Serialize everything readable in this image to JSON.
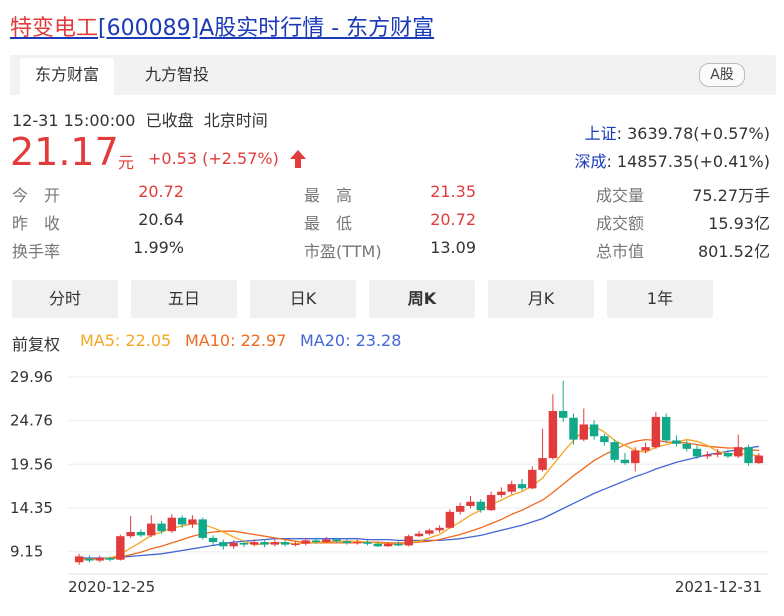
{
  "header": {
    "stock_name": "特变电工",
    "title_rest": "[600089]A股实时行情 - 东方财富"
  },
  "tabs": [
    "东方财富",
    "九方智投"
  ],
  "market_badge": "A股",
  "status": {
    "datetime": "12-31 15:00:00",
    "state": "已收盘",
    "timezone": "北京时间"
  },
  "price": {
    "value": "21.17",
    "unit": "元",
    "change": "+0.53 (+2.57%)"
  },
  "indices": [
    {
      "name": "上证",
      "value": ": 3639.78(+0.57%)"
    },
    {
      "name": "深成",
      "value": ": 14857.35(+0.41%)"
    }
  ],
  "quote": {
    "col1": [
      {
        "label": "今　开",
        "value": "20.72",
        "color": "#e23b3b"
      },
      {
        "label": "昨　收",
        "value": "20.64",
        "color": "#333333"
      },
      {
        "label": "换手率",
        "value": "1.99%",
        "color": "#333333"
      }
    ],
    "col2": [
      {
        "label": "最　高",
        "value": "21.35",
        "color": "#e23b3b"
      },
      {
        "label": "最　低",
        "value": "20.72",
        "color": "#e23b3b"
      },
      {
        "label": "市盈(TTM)",
        "value": "13.09",
        "color": "#333333"
      }
    ],
    "col3": [
      {
        "label": "成交量",
        "value": "75.27万手"
      },
      {
        "label": "成交额",
        "value": "15.93亿"
      },
      {
        "label": "总市值",
        "value": "801.52亿"
      }
    ]
  },
  "periods": [
    "分时",
    "五日",
    "日K",
    "周K",
    "月K",
    "1年"
  ],
  "active_period": "周K",
  "adjust_label": "前复权",
  "ma": {
    "ma5": "MA5: 22.05",
    "ma10": "MA10: 22.97",
    "ma20": "MA20: 23.28"
  },
  "colors": {
    "up": "#e23b3b",
    "down": "#12a88a",
    "ma5": "#f5a623",
    "ma10": "#f06a1e",
    "ma20": "#4466d8",
    "link": "#1a3ab8"
  },
  "chart_data": {
    "type": "candlestick",
    "y_ticks": [
      "29.96",
      "24.76",
      "19.56",
      "14.35",
      "9.15"
    ],
    "ylim": [
      6.5,
      31.5
    ],
    "x_labels": {
      "start": "2020-12-25",
      "end": "2021-12-31"
    },
    "grid": true,
    "candles": [
      [
        7.9,
        8.6,
        7.6,
        8.9
      ],
      [
        8.3,
        8.1,
        7.9,
        8.7
      ],
      [
        8.1,
        8.4,
        7.9,
        8.7
      ],
      [
        8.4,
        8.2,
        8.0,
        8.6
      ],
      [
        8.2,
        11.0,
        8.1,
        11.2
      ],
      [
        11.0,
        11.5,
        10.8,
        13.4
      ],
      [
        11.5,
        11.1,
        10.9,
        11.8
      ],
      [
        11.1,
        12.5,
        10.9,
        13.5
      ],
      [
        12.5,
        11.6,
        11.3,
        12.8
      ],
      [
        11.6,
        13.2,
        11.4,
        13.6
      ],
      [
        13.2,
        12.4,
        12.0,
        13.5
      ],
      [
        12.4,
        13.0,
        12.0,
        13.5
      ],
      [
        13.0,
        10.8,
        10.6,
        13.2
      ],
      [
        10.8,
        10.3,
        10.0,
        11.1
      ],
      [
        10.3,
        9.8,
        9.4,
        10.6
      ],
      [
        9.8,
        10.2,
        9.5,
        10.5
      ],
      [
        10.2,
        10.0,
        9.7,
        10.5
      ],
      [
        10.0,
        10.3,
        9.8,
        10.6
      ],
      [
        10.3,
        10.0,
        9.7,
        10.5
      ],
      [
        10.0,
        10.3,
        9.8,
        10.6
      ],
      [
        10.3,
        10.0,
        9.8,
        10.5
      ],
      [
        10.0,
        10.1,
        9.8,
        10.4
      ],
      [
        10.1,
        10.5,
        9.9,
        10.8
      ],
      [
        10.5,
        10.3,
        10.1,
        10.8
      ],
      [
        10.3,
        10.6,
        10.2,
        10.9
      ],
      [
        10.6,
        10.4,
        10.2,
        10.8
      ],
      [
        10.4,
        10.2,
        10.0,
        10.6
      ],
      [
        10.2,
        10.3,
        10.0,
        10.6
      ],
      [
        10.3,
        10.1,
        9.9,
        10.5
      ],
      [
        10.1,
        9.8,
        9.7,
        10.3
      ],
      [
        9.8,
        10.1,
        9.7,
        10.3
      ],
      [
        10.1,
        9.9,
        9.8,
        10.4
      ],
      [
        9.9,
        11.0,
        9.8,
        11.2
      ],
      [
        11.0,
        11.3,
        10.9,
        11.6
      ],
      [
        11.3,
        11.7,
        11.1,
        11.9
      ],
      [
        11.7,
        12.0,
        11.4,
        12.3
      ],
      [
        12.0,
        13.9,
        11.9,
        14.2
      ],
      [
        13.9,
        14.6,
        13.6,
        15.0
      ],
      [
        14.6,
        15.1,
        14.3,
        15.8
      ],
      [
        15.1,
        14.1,
        13.8,
        15.4
      ],
      [
        14.1,
        15.9,
        14.0,
        16.3
      ],
      [
        15.9,
        16.3,
        15.6,
        16.8
      ],
      [
        16.3,
        17.2,
        16.0,
        17.6
      ],
      [
        17.2,
        16.7,
        16.4,
        17.8
      ],
      [
        16.7,
        18.9,
        16.6,
        19.3
      ],
      [
        18.9,
        20.3,
        18.7,
        23.8
      ],
      [
        20.3,
        25.9,
        20.1,
        27.9
      ],
      [
        25.9,
        25.1,
        24.6,
        29.5
      ],
      [
        25.1,
        22.5,
        21.9,
        25.6
      ],
      [
        22.5,
        24.3,
        22.3,
        26.2
      ],
      [
        24.3,
        22.9,
        22.5,
        24.8
      ],
      [
        22.9,
        22.2,
        21.8,
        23.2
      ],
      [
        22.2,
        20.1,
        19.8,
        22.5
      ],
      [
        20.1,
        19.7,
        19.5,
        20.9
      ],
      [
        19.7,
        21.2,
        18.7,
        21.6
      ],
      [
        21.2,
        21.6,
        20.9,
        22.1
      ],
      [
        21.6,
        25.2,
        21.4,
        25.8
      ],
      [
        25.2,
        22.4,
        22.1,
        25.6
      ],
      [
        22.4,
        22.0,
        21.7,
        23.0
      ],
      [
        22.0,
        21.4,
        21.1,
        22.4
      ],
      [
        21.4,
        20.5,
        20.2,
        21.8
      ],
      [
        20.5,
        20.7,
        20.2,
        21.1
      ],
      [
        20.7,
        20.9,
        20.4,
        21.4
      ],
      [
        20.9,
        20.5,
        20.3,
        21.3
      ],
      [
        20.5,
        21.6,
        20.3,
        23.1
      ],
      [
        21.6,
        19.7,
        19.4,
        21.9
      ],
      [
        19.7,
        20.6,
        19.6,
        20.9
      ]
    ],
    "ma5": [
      8.2,
      8.2,
      8.3,
      8.4,
      8.8,
      9.6,
      10.3,
      11.1,
      11.5,
      12.0,
      12.2,
      12.5,
      12.4,
      12.0,
      11.5,
      10.9,
      10.4,
      10.0,
      10.1,
      10.2,
      10.2,
      10.1,
      10.2,
      10.3,
      10.3,
      10.4,
      10.4,
      10.4,
      10.3,
      10.2,
      10.1,
      10.0,
      10.2,
      10.4,
      10.8,
      11.2,
      12.0,
      12.7,
      13.5,
      14.1,
      14.8,
      15.3,
      15.9,
      16.3,
      17.0,
      17.9,
      19.5,
      21.0,
      22.4,
      23.6,
      24.1,
      23.4,
      22.4,
      21.8,
      21.2,
      21.0,
      21.6,
      21.9,
      22.2,
      22.5,
      22.3,
      21.8,
      21.1,
      20.8,
      20.8,
      20.7,
      20.6
    ],
    "ma10": [
      8.3,
      8.3,
      8.3,
      8.3,
      8.5,
      8.8,
      9.1,
      9.5,
      9.8,
      10.2,
      10.6,
      11.0,
      11.3,
      11.5,
      11.6,
      11.6,
      11.4,
      11.2,
      11.0,
      10.8,
      10.6,
      10.4,
      10.2,
      10.2,
      10.2,
      10.2,
      10.2,
      10.2,
      10.3,
      10.3,
      10.2,
      10.2,
      10.2,
      10.3,
      10.4,
      10.6,
      10.9,
      11.2,
      11.6,
      12.0,
      12.5,
      13.0,
      13.6,
      14.1,
      14.7,
      15.3,
      16.2,
      17.2,
      18.2,
      19.1,
      20.0,
      20.7,
      21.3,
      21.9,
      22.3,
      22.5,
      22.4,
      22.2,
      22.2,
      22.1,
      21.9,
      21.7,
      21.6,
      21.5,
      21.5,
      21.3,
      21.2
    ],
    "ma20": [
      8.4,
      8.4,
      8.4,
      8.4,
      8.5,
      8.6,
      8.7,
      8.8,
      8.9,
      9.1,
      9.3,
      9.5,
      9.7,
      9.9,
      10.1,
      10.3,
      10.4,
      10.5,
      10.6,
      10.7,
      10.7,
      10.7,
      10.7,
      10.7,
      10.7,
      10.7,
      10.7,
      10.7,
      10.6,
      10.6,
      10.6,
      10.5,
      10.5,
      10.5,
      10.5,
      10.5,
      10.6,
      10.7,
      10.9,
      11.1,
      11.4,
      11.7,
      12.0,
      12.3,
      12.7,
      13.1,
      13.7,
      14.3,
      14.9,
      15.5,
      16.1,
      16.6,
      17.1,
      17.6,
      18.1,
      18.5,
      19.0,
      19.4,
      19.8,
      20.1,
      20.4,
      20.7,
      20.9,
      21.1,
      21.3,
      21.5,
      21.7
    ]
  }
}
